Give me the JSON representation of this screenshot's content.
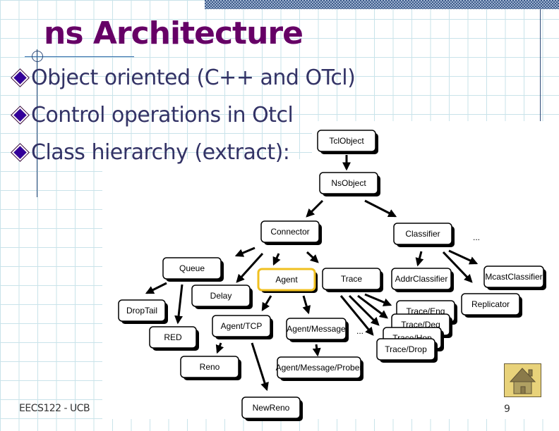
{
  "slide": {
    "title": "ns Architecture",
    "bullets": [
      "Object oriented (C++ and OTcl)",
      "Control operations in Otcl",
      "Class hierarchy (extract):"
    ],
    "footer": "EECS122 - UCB",
    "page_number": "9",
    "home_button_icon": "home-icon"
  },
  "diagram": {
    "highlight_color": "#f0c020",
    "nodes": [
      {
        "id": "tclobject",
        "label": "TclObject"
      },
      {
        "id": "nsobject",
        "label": "NsObject"
      },
      {
        "id": "connector",
        "label": "Connector"
      },
      {
        "id": "classifier",
        "label": "Classifier"
      },
      {
        "id": "queue",
        "label": "Queue"
      },
      {
        "id": "delay",
        "label": "Delay"
      },
      {
        "id": "agent",
        "label": "Agent",
        "highlighted": true
      },
      {
        "id": "trace",
        "label": "Trace"
      },
      {
        "id": "addrclassifier",
        "label": "AddrClassifier"
      },
      {
        "id": "mcastclassifier",
        "label": "McastClassifier"
      },
      {
        "id": "replicator",
        "label": "Replicator"
      },
      {
        "id": "droptail",
        "label": "DropTail"
      },
      {
        "id": "red",
        "label": "RED"
      },
      {
        "id": "agenttcp",
        "label": "Agent/TCP"
      },
      {
        "id": "agentmessage",
        "label": "Agent/Message"
      },
      {
        "id": "traceenq",
        "label": "Trace/Enq"
      },
      {
        "id": "tracedeq",
        "label": "Trace/Deq"
      },
      {
        "id": "tracehop",
        "label": "Trace/Hop"
      },
      {
        "id": "tracedrop",
        "label": "Trace/Drop"
      },
      {
        "id": "reno",
        "label": "Reno"
      },
      {
        "id": "agentmessageprober",
        "label": "Agent/Message/Prober"
      },
      {
        "id": "newreno",
        "label": "NewReno"
      }
    ],
    "edges": [
      [
        "tclobject",
        "nsobject"
      ],
      [
        "nsobject",
        "connector"
      ],
      [
        "nsobject",
        "classifier"
      ],
      [
        "connector",
        "queue"
      ],
      [
        "connector",
        "delay"
      ],
      [
        "connector",
        "agent"
      ],
      [
        "connector",
        "trace"
      ],
      [
        "classifier",
        "addrclassifier"
      ],
      [
        "classifier",
        "mcastclassifier"
      ],
      [
        "classifier",
        "replicator"
      ],
      [
        "queue",
        "droptail"
      ],
      [
        "queue",
        "red"
      ],
      [
        "agent",
        "agenttcp"
      ],
      [
        "agent",
        "agentmessage"
      ],
      [
        "trace",
        "traceenq"
      ],
      [
        "trace",
        "tracedeq"
      ],
      [
        "trace",
        "tracehop"
      ],
      [
        "trace",
        "tracedrop"
      ],
      [
        "agenttcp",
        "reno"
      ],
      [
        "agenttcp",
        "newreno"
      ],
      [
        "agentmessage",
        "agentmessageprober"
      ]
    ],
    "ellipses": [
      "classifier-more",
      "agent-more",
      "connector-more"
    ],
    "ellipsis_text": "..."
  }
}
